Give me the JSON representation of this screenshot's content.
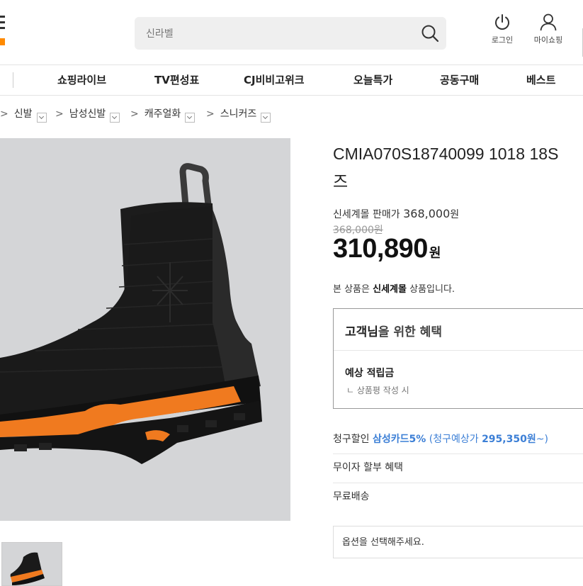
{
  "header": {
    "search_placeholder": "신라벨",
    "login_label": "로그인",
    "mypage_label": "마이쇼핑"
  },
  "nav": {
    "items": [
      "쇼핑라이브",
      "TV편성표",
      "CJ비비고위크",
      "오늘특가",
      "공동구매",
      "베스트"
    ]
  },
  "breadcrumb": {
    "items": [
      "신발",
      "남성신발",
      "캐주얼화",
      "스니커즈"
    ]
  },
  "product": {
    "title_line1": "CMIA070S18740099 1018 18S",
    "title_line2": "즈",
    "seller_price_label": "신세계몰 판매가",
    "seller_price": "368,000",
    "seller_price_unit": "원",
    "original_price": "368,000",
    "original_price_unit": "원",
    "sale_price": "310,890",
    "sale_price_unit": "원",
    "notice_prefix": "본 상품은",
    "notice_brand": "신세계몰",
    "notice_suffix": "상품입니다."
  },
  "benefit": {
    "heading_strong": "고객님",
    "heading_rest": "을 위한 혜택",
    "points_label": "예상 적립금",
    "points_sub": "ㄴ 상품평 작성 시"
  },
  "discount": {
    "label": "청구할인",
    "card": "삼성카드5%",
    "expected_prefix": "(청구예상가",
    "expected_price": "295,350원",
    "expected_suffix": "~)"
  },
  "installment_label": "무이자 할부 혜택",
  "shipping_label": "무료배송",
  "option_placeholder": "옵션을 선택해주세요.",
  "icons": {
    "search": "search-icon",
    "power": "power-icon",
    "person": "person-icon",
    "chevron": "chevron-down-icon",
    "menu": "menu-icon"
  },
  "colors": {
    "accent": "#ff8a00",
    "link_blue": "#3c7fd6",
    "image_bg": "#d4d5d7"
  }
}
